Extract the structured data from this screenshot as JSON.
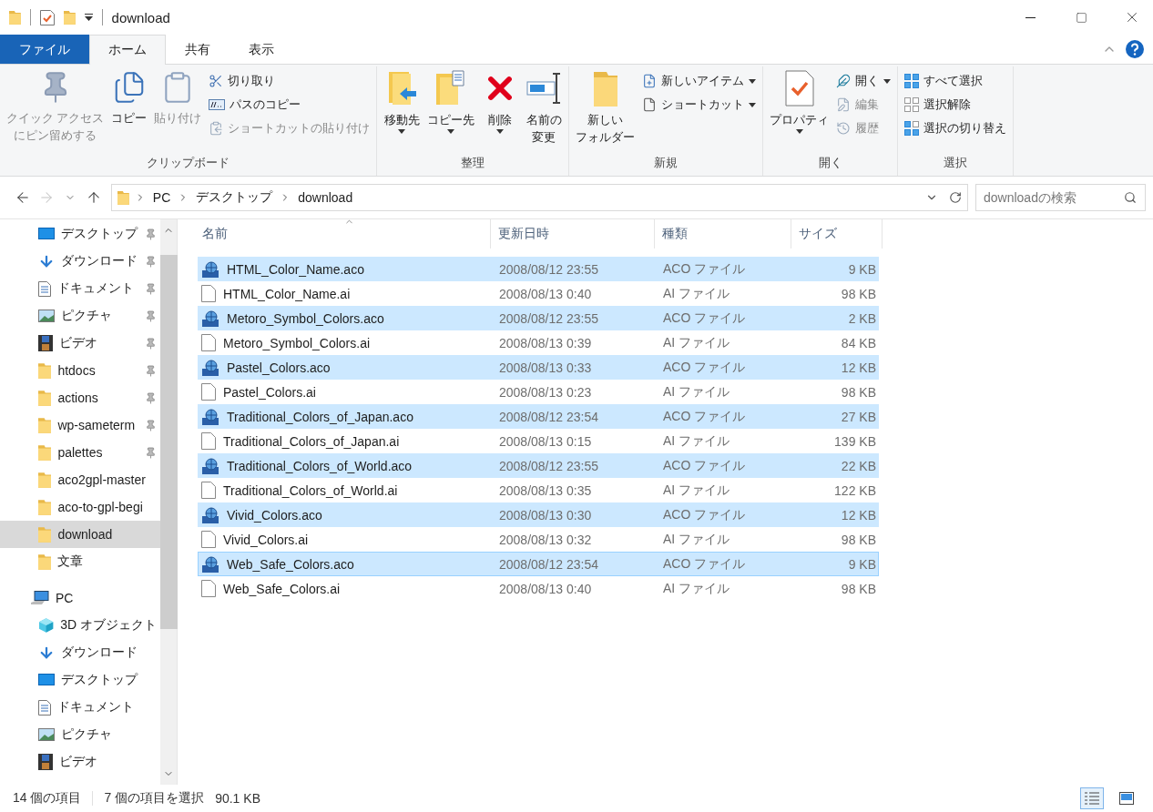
{
  "window": {
    "title": "download"
  },
  "ribbon": {
    "tabs": [
      {
        "label": "ファイル",
        "kind": "file",
        "selected": false
      },
      {
        "label": "ホーム",
        "kind": "tab",
        "selected": true
      },
      {
        "label": "共有",
        "kind": "tab",
        "selected": false
      },
      {
        "label": "表示",
        "kind": "tab",
        "selected": false
      }
    ],
    "groups": [
      {
        "label": "クリップボード",
        "items": [
          {
            "kind": "large",
            "label_lines": [
              "クイック アクセス",
              "にピン留めする"
            ],
            "disabled": true,
            "dropdown": false
          },
          {
            "kind": "large",
            "label": "コピー",
            "disabled": false,
            "dropdown": false
          },
          {
            "kind": "large",
            "label": "貼り付け",
            "disabled": true,
            "dropdown": false
          },
          {
            "kind": "small",
            "label": "切り取り",
            "disabled": false,
            "dropdown": false
          },
          {
            "kind": "small",
            "label": "パスのコピー",
            "disabled": false,
            "dropdown": false
          },
          {
            "kind": "small",
            "label": "ショートカットの貼り付け",
            "disabled": true,
            "dropdown": false
          }
        ]
      },
      {
        "label": "整理",
        "items": [
          {
            "kind": "large",
            "label": "移動先",
            "disabled": false,
            "dropdown": true
          },
          {
            "kind": "large",
            "label": "コピー先",
            "disabled": false,
            "dropdown": true
          },
          {
            "kind": "large",
            "label": "削除",
            "disabled": false,
            "dropdown": true
          },
          {
            "kind": "large",
            "label_lines": [
              "名前の",
              "変更"
            ],
            "disabled": false,
            "dropdown": false
          }
        ]
      },
      {
        "label": "新規",
        "items": [
          {
            "kind": "large",
            "label_lines": [
              "新しい",
              "フォルダー"
            ],
            "disabled": false,
            "dropdown": false
          },
          {
            "kind": "small",
            "label": "新しいアイテム",
            "disabled": false,
            "dropdown": true
          },
          {
            "kind": "small",
            "label": "ショートカット",
            "disabled": false,
            "dropdown": true
          }
        ]
      },
      {
        "label": "開く",
        "items": [
          {
            "kind": "large",
            "label": "プロパティ",
            "disabled": false,
            "dropdown": true
          },
          {
            "kind": "small",
            "label": "開く",
            "disabled": false,
            "dropdown": true
          },
          {
            "kind": "small",
            "label": "編集",
            "disabled": true,
            "dropdown": false
          },
          {
            "kind": "small",
            "label": "履歴",
            "disabled": true,
            "dropdown": false
          }
        ]
      },
      {
        "label": "選択",
        "items": [
          {
            "kind": "small",
            "label": "すべて選択",
            "disabled": false,
            "dropdown": false
          },
          {
            "kind": "small",
            "label": "選択解除",
            "disabled": false,
            "dropdown": false
          },
          {
            "kind": "small",
            "label": "選択の切り替え",
            "disabled": false,
            "dropdown": false
          }
        ]
      }
    ]
  },
  "address_bar": {
    "buttons": [
      {
        "kind": "back",
        "disabled": false
      },
      {
        "kind": "forward",
        "disabled": true
      },
      {
        "kind": "recent",
        "disabled": false
      },
      {
        "kind": "up",
        "disabled": false
      }
    ],
    "path": [
      "PC",
      "デスクトップ",
      "download"
    ],
    "search": {
      "placeholder": "downloadの検索"
    }
  },
  "navigation": {
    "quick_access": [
      {
        "label": "デスクトップ",
        "kind": "desktop",
        "pinned": true,
        "selected": false
      },
      {
        "label": "ダウンロード",
        "kind": "download",
        "pinned": true,
        "selected": false
      },
      {
        "label": "ドキュメント",
        "kind": "document",
        "pinned": true,
        "selected": false
      },
      {
        "label": "ピクチャ",
        "kind": "picture",
        "pinned": true,
        "selected": false
      },
      {
        "label": "ビデオ",
        "kind": "video",
        "pinned": true,
        "selected": false
      },
      {
        "label": "htdocs",
        "kind": "folder",
        "pinned": true,
        "selected": false
      },
      {
        "label": "actions",
        "kind": "folder",
        "pinned": true,
        "selected": false
      },
      {
        "label": "wp-sameterm",
        "kind": "folder",
        "pinned": true,
        "selected": false
      },
      {
        "label": "palettes",
        "kind": "folder",
        "pinned": true,
        "selected": false
      },
      {
        "label": "aco2gpl-master",
        "kind": "folder",
        "pinned": false,
        "selected": false
      },
      {
        "label": "aco-to-gpl-begi",
        "kind": "folder",
        "pinned": false,
        "selected": false
      },
      {
        "label": "download",
        "kind": "folder",
        "pinned": false,
        "selected": true
      },
      {
        "label": "文章",
        "kind": "folder",
        "pinned": false,
        "selected": false
      }
    ],
    "pc": {
      "label": "PC",
      "kind": "pc",
      "selected": false,
      "children": [
        {
          "label": "3D オブジェクト",
          "kind": "objects",
          "selected": false
        },
        {
          "label": "ダウンロード",
          "kind": "download",
          "selected": false
        },
        {
          "label": "デスクトップ",
          "kind": "desktop",
          "selected": false
        },
        {
          "label": "ドキュメント",
          "kind": "document",
          "selected": false
        },
        {
          "label": "ピクチャ",
          "kind": "picture",
          "selected": false
        },
        {
          "label": "ビデオ",
          "kind": "video",
          "selected": false
        }
      ]
    }
  },
  "files": {
    "columns": [
      {
        "label": "名前",
        "sorted": true
      },
      {
        "label": "更新日時",
        "sorted": false
      },
      {
        "label": "種類",
        "sorted": false
      },
      {
        "label": "サイズ",
        "sorted": false
      }
    ],
    "rows": [
      {
        "name": "HTML_Color_Name.aco",
        "date": "2008/08/12 23:55",
        "type": "ACO ファイル",
        "size": "9 KB",
        "kind": "aco",
        "selected": true,
        "focused": false
      },
      {
        "name": "HTML_Color_Name.ai",
        "date": "2008/08/13 0:40",
        "type": "AI ファイル",
        "size": "98 KB",
        "kind": "ai",
        "selected": false,
        "focused": false
      },
      {
        "name": "Metoro_Symbol_Colors.aco",
        "date": "2008/08/12 23:55",
        "type": "ACO ファイル",
        "size": "2 KB",
        "kind": "aco",
        "selected": true,
        "focused": false
      },
      {
        "name": "Metoro_Symbol_Colors.ai",
        "date": "2008/08/13 0:39",
        "type": "AI ファイル",
        "size": "84 KB",
        "kind": "ai",
        "selected": false,
        "focused": false
      },
      {
        "name": "Pastel_Colors.aco",
        "date": "2008/08/13 0:33",
        "type": "ACO ファイル",
        "size": "12 KB",
        "kind": "aco",
        "selected": true,
        "focused": false
      },
      {
        "name": "Pastel_Colors.ai",
        "date": "2008/08/13 0:23",
        "type": "AI ファイル",
        "size": "98 KB",
        "kind": "ai",
        "selected": false,
        "focused": false
      },
      {
        "name": "Traditional_Colors_of_Japan.aco",
        "date": "2008/08/12 23:54",
        "type": "ACO ファイル",
        "size": "27 KB",
        "kind": "aco",
        "selected": true,
        "focused": false
      },
      {
        "name": "Traditional_Colors_of_Japan.ai",
        "date": "2008/08/13 0:15",
        "type": "AI ファイル",
        "size": "139 KB",
        "kind": "ai",
        "selected": false,
        "focused": false
      },
      {
        "name": "Traditional_Colors_of_World.aco",
        "date": "2008/08/12 23:55",
        "type": "ACO ファイル",
        "size": "22 KB",
        "kind": "aco",
        "selected": true,
        "focused": false
      },
      {
        "name": "Traditional_Colors_of_World.ai",
        "date": "2008/08/13 0:35",
        "type": "AI ファイル",
        "size": "122 KB",
        "kind": "ai",
        "selected": false,
        "focused": false
      },
      {
        "name": "Vivid_Colors.aco",
        "date": "2008/08/13 0:30",
        "type": "ACO ファイル",
        "size": "12 KB",
        "kind": "aco",
        "selected": true,
        "focused": false
      },
      {
        "name": "Vivid_Colors.ai",
        "date": "2008/08/13 0:32",
        "type": "AI ファイル",
        "size": "98 KB",
        "kind": "ai",
        "selected": false,
        "focused": false
      },
      {
        "name": "Web_Safe_Colors.aco",
        "date": "2008/08/12 23:54",
        "type": "ACO ファイル",
        "size": "9 KB",
        "kind": "aco",
        "selected": true,
        "focused": true
      },
      {
        "name": "Web_Safe_Colors.ai",
        "date": "2008/08/13 0:40",
        "type": "AI ファイル",
        "size": "98 KB",
        "kind": "ai",
        "selected": false,
        "focused": false
      }
    ]
  },
  "status_bar": {
    "item_count": "14 個の項目",
    "selection": "7 個の項目を選択",
    "selection_size": "90.1 KB",
    "views": [
      {
        "kind": "details",
        "selected": true
      },
      {
        "kind": "large_icons",
        "selected": false
      }
    ]
  }
}
